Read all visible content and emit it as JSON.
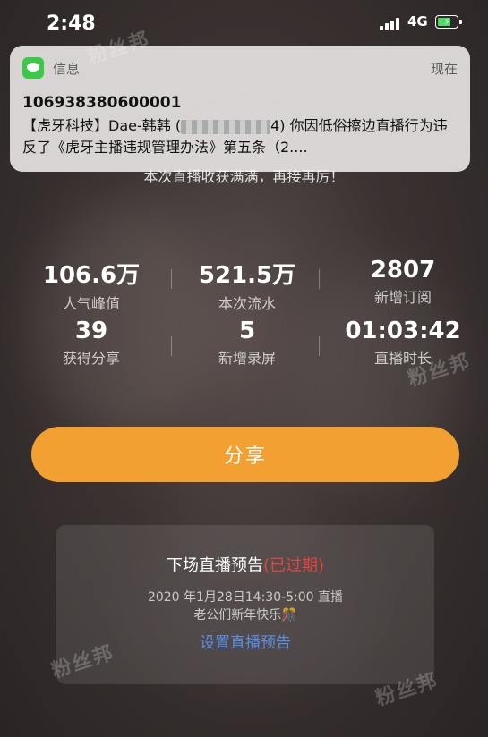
{
  "status_bar": {
    "time": "2:48",
    "network": "4G"
  },
  "notification": {
    "app_name": "信息",
    "when": "现在",
    "sender": "106938380600001",
    "body_prefix": "【虎牙科技】Dae-韩韩 (",
    "body_suffix": "4) 你因低俗擦边直播行为违反了《虎牙主播违规管理办法》第五条（2...."
  },
  "background_text": "本次直播收获满满，再接再厉！",
  "stats": [
    {
      "value": "106.6万",
      "label": "人气峰值"
    },
    {
      "value": "521.5万",
      "label": "本次流水"
    },
    {
      "value": "2807",
      "label": "新增订阅"
    },
    {
      "value": "39",
      "label": "获得分享"
    },
    {
      "value": "5",
      "label": "新增录屏"
    },
    {
      "value": "01:03:42",
      "label": "直播时长"
    }
  ],
  "share_button": "分享",
  "preview_card": {
    "title": "下场直播预告",
    "expired": "(已过期)",
    "schedule": "2020 年1月28日14:30-5:00 直播",
    "description": "老公们新年快乐🎊",
    "link": "设置直播预告"
  },
  "watermark": "粉丝邦"
}
